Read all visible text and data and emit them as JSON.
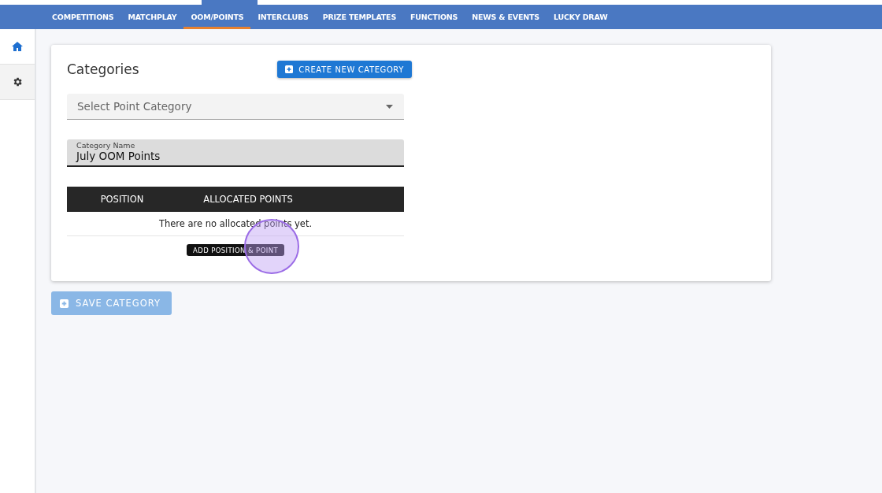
{
  "nav": {
    "items": [
      {
        "label": "COMPETITIONS",
        "selected": false
      },
      {
        "label": "MATCHPLAY",
        "selected": false
      },
      {
        "label": "OOM/POINTS",
        "selected": true
      },
      {
        "label": "INTERCLUBS",
        "selected": false
      },
      {
        "label": "PRIZE TEMPLATES",
        "selected": false
      },
      {
        "label": "FUNCTIONS",
        "selected": false
      },
      {
        "label": "NEWS & EVENTS",
        "selected": false
      },
      {
        "label": "LUCKY DRAW",
        "selected": false
      }
    ]
  },
  "sidebar": {
    "items": [
      {
        "kind": "home",
        "selected": true
      },
      {
        "kind": "settings",
        "selected": false
      }
    ]
  },
  "card": {
    "title": "Categories",
    "create_button": "CREATE NEW CATEGORY",
    "select": {
      "placeholder": "Select Point Category"
    },
    "name_field": {
      "label": "Category Name",
      "value": "July OOM Points"
    },
    "table": {
      "columns": [
        "POSITION",
        "ALLOCATED POINTS"
      ],
      "empty_message": "There are no allocated points yet."
    },
    "add_button": "ADD POSITION & POINT"
  },
  "save_button": {
    "label": "SAVE CATEGORY",
    "disabled": true
  }
}
